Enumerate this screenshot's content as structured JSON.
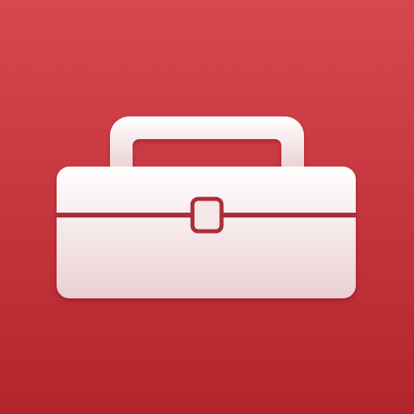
{
  "icon": {
    "name": "toolbox-icon",
    "colors": {
      "background_top": "#d84750",
      "background_bottom": "#b3242d",
      "toolbox_top": "#ffffff",
      "toolbox_bottom": "#ead0d2",
      "seam": "#ab2f37",
      "latch_fill": "#f5e6e8"
    }
  }
}
